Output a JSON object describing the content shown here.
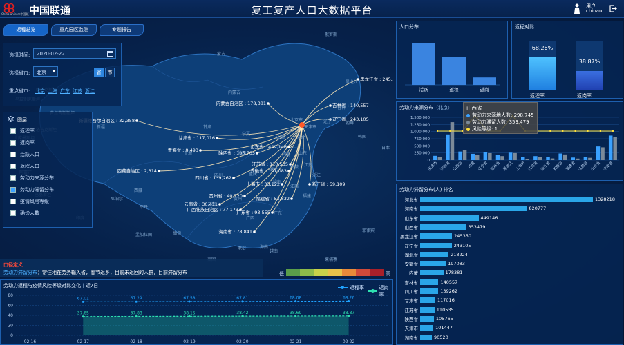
{
  "header": {
    "logo_cn": "中国联通",
    "logo_en": "China unicom中国联通",
    "title": "复工复产人口大数据平台",
    "user_label": "用户",
    "user_name": "chinau...",
    "icon_user": "user-icon",
    "icon_logout": "logout-icon"
  },
  "tabs": [
    {
      "label": "返程总览",
      "active": true
    },
    {
      "label": "重点园区监测",
      "active": false
    },
    {
      "label": "专题报告",
      "active": false
    }
  ],
  "filter": {
    "time_label": "选择时间:",
    "time_value": "2020-02-22",
    "province_label": "选择省市:",
    "province_value": "北京",
    "sheng": "省",
    "shi": "市",
    "key_label": "重点省市:",
    "key_provinces": [
      "北京",
      "上海",
      "广东",
      "江苏",
      "浙江"
    ]
  },
  "layers": {
    "title": "图层",
    "items": [
      {
        "label": "返程率",
        "checked": false
      },
      {
        "label": "返岗率",
        "checked": false
      },
      {
        "label": "活跃人口",
        "checked": false
      },
      {
        "label": "返程人口",
        "checked": false
      },
      {
        "label": "劳动力来源分布",
        "checked": false
      },
      {
        "label": "劳动力滞留分布",
        "checked": true
      },
      {
        "label": "疫情风险等级",
        "checked": false
      },
      {
        "label": "确诊人数",
        "checked": false
      }
    ]
  },
  "map": {
    "target": "北京",
    "routes": [
      {
        "name": "黑龙江省",
        "value": "245,350"
      },
      {
        "name": "内蒙古自治区",
        "value": "178,381"
      },
      {
        "name": "吉林省",
        "value": "140,557"
      },
      {
        "name": "新疆维吾尔自治区",
        "value": "32,358"
      },
      {
        "name": "辽宁省",
        "value": "243,105"
      },
      {
        "name": "甘肃省",
        "value": "117,016"
      },
      {
        "name": "山东省",
        "value": "449,146"
      },
      {
        "name": "青海省",
        "value": "8,493"
      },
      {
        "name": "陕西省",
        "value": "105,765"
      },
      {
        "name": "西藏自治区",
        "value": "2,314"
      },
      {
        "name": "四川省",
        "value": "139,262"
      },
      {
        "name": "安徽省",
        "value": "197,083"
      },
      {
        "name": "江苏省",
        "value": "110,535"
      },
      {
        "name": "上海市",
        "value": "33,122"
      },
      {
        "name": "浙江省",
        "value": "59,109"
      },
      {
        "name": "贵州省",
        "value": "40,720"
      },
      {
        "name": "云南省",
        "value": "30,411"
      },
      {
        "name": "福建省",
        "value": "53,832"
      },
      {
        "name": "广西壮族自治区",
        "value": "77,173"
      },
      {
        "name": "广东省",
        "value": "93,555"
      },
      {
        "name": "海南省",
        "value": "78,841"
      }
    ],
    "place_labels": [
      "黑龙江",
      "吉林",
      "辽宁",
      "北京市",
      "天津市",
      "河北",
      "山东",
      "山西",
      "河南",
      "安徽",
      "江苏",
      "湖北",
      "浙江",
      "湖南",
      "江西",
      "福建",
      "广东",
      "广西",
      "海南",
      "贵州",
      "云南",
      "四川",
      "重庆",
      "青海",
      "甘肃",
      "宁夏",
      "陕西",
      "西藏",
      "新疆",
      "内蒙古",
      "蒙古",
      "吉尔吉斯斯坦",
      "阿富汗",
      "巴基斯坦",
      "印度",
      "尼泊尔",
      "不丹",
      "缅甸",
      "泰国",
      "老挝",
      "越南",
      "柬埔寨",
      "菲律宾",
      "韩国",
      "日本",
      "朝鲜",
      "孟加拉国",
      "塔吉克斯坦",
      "哈萨克斯坦",
      "俄罗斯",
      "乌兹别克斯坦",
      "土库曼斯坦"
    ],
    "legend_low": "低",
    "legend_high": "高",
    "legend_colors": [
      "#5a9e4a",
      "#8dbb4a",
      "#c8d24a",
      "#e8c24a",
      "#e88a3a",
      "#d04a3a",
      "#a8202a"
    ]
  },
  "definition": {
    "title": "口径定义",
    "label": "劳动力滞留分布",
    "text": "：常住地在劳务输入省，春节返乡，目前未返回的人群，目前滞留分布"
  },
  "population": {
    "title": "人口分布",
    "chart_data": {
      "type": "bar",
      "categories": [
        "活跃",
        "返程",
        "返岗"
      ],
      "values": [
        100,
        68,
        18
      ]
    }
  },
  "comparison": {
    "title": "返程对比",
    "items": [
      {
        "label": "返程率",
        "value": "68.26%",
        "pct": 68.26
      },
      {
        "label": "返岗率",
        "value": "38.87%",
        "pct": 38.87
      }
    ]
  },
  "source": {
    "title": "劳动力来源分布",
    "subtitle": "（北京）",
    "tooltip": {
      "title": "山西省",
      "lines": [
        "劳动力来源地人数: 298,745",
        "劳动力滞留人数: 353,479",
        "风险等级: 1"
      ]
    },
    "chart_data": {
      "type": "bar",
      "categories": [
        "天津市",
        "河北省",
        "山西省",
        "内蒙",
        "辽宁省",
        "吉林省",
        "黑龙江",
        "上海市",
        "江苏省",
        "浙江省",
        "安徽省",
        "福建省",
        "江西省",
        "山东省",
        "河南省"
      ],
      "yticks": [
        "0",
        "250,000",
        "500,000",
        "750,000",
        "1,000,000",
        "1,250,000",
        "1,500,000"
      ],
      "ylim": [
        0,
        1500000
      ],
      "series": [
        {
          "name": "劳动力来源地人数",
          "values": [
            150000,
            900000,
            298745,
            220000,
            280000,
            180000,
            260000,
            120000,
            140000,
            110000,
            230000,
            90000,
            120000,
            480000,
            860000
          ]
        },
        {
          "name": "劳动力滞留人数",
          "values": [
            101447,
            1328218,
            353479,
            178381,
            243105,
            140557,
            245350,
            33122,
            110535,
            59109,
            197083,
            53832,
            80000,
            449146,
            820777
          ]
        },
        {
          "name": "风险等级",
          "values": [
            1,
            1,
            1,
            2,
            1,
            1,
            2,
            1,
            1,
            1,
            1,
            1,
            1,
            1,
            1
          ]
        }
      ]
    }
  },
  "ranking": {
    "title": "劳动力滞留分布(人) 排名",
    "chart_data": {
      "type": "bar",
      "categories": [
        "河北省",
        "河南省",
        "山东省",
        "山西省",
        "黑龙江省",
        "辽宁省",
        "湖北省",
        "安徽省",
        "内蒙",
        "吉林省",
        "四川省",
        "甘肃省",
        "江苏省",
        "陕西省",
        "天津市",
        "湖南省"
      ],
      "values": [
        1328218,
        820777,
        449146,
        353479,
        245350,
        243105,
        218224,
        197083,
        178381,
        140557,
        139262,
        117016,
        110535,
        105765,
        101447,
        90520
      ]
    }
  },
  "trend": {
    "title": "劳动力返程与疫情风险等级对比变化",
    "period": "近7日",
    "legend": [
      "返程率",
      "返岗率"
    ],
    "chart_data": {
      "type": "line",
      "x": [
        "02-16",
        "02-17",
        "02-18",
        "02-19",
        "02-20",
        "02-21",
        "02-22"
      ],
      "yticks": [
        "0",
        "20",
        "40",
        "60",
        "80"
      ],
      "ylim": [
        0,
        80
      ],
      "series": [
        {
          "name": "返程率",
          "values": [
            null,
            67.01,
            67.29,
            67.58,
            67.81,
            68.08,
            68.26
          ],
          "labels": [
            "67.01",
            "67.29",
            "67.58",
            "67.81",
            "68.08",
            "68.26"
          ]
        },
        {
          "name": "返岗率",
          "values": [
            null,
            37.65,
            37.88,
            38.15,
            38.42,
            38.69,
            38.87
          ],
          "labels": [
            "37.65",
            "37.88",
            "38.15",
            "38.42",
            "38.69",
            "38.87"
          ]
        }
      ]
    }
  }
}
